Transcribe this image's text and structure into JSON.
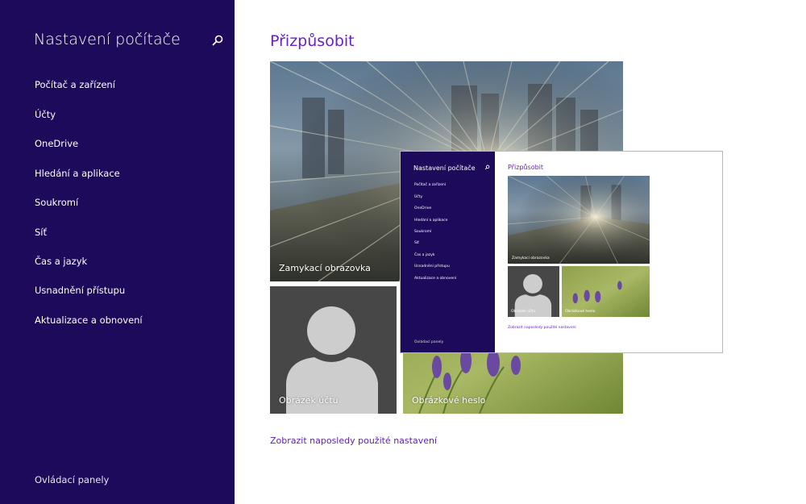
{
  "sidebar": {
    "title": "Nastavení počítače",
    "items": [
      {
        "label": "Počítač a zařízení"
      },
      {
        "label": "Účty"
      },
      {
        "label": "OneDrive"
      },
      {
        "label": "Hledání a aplikace"
      },
      {
        "label": "Soukromí"
      },
      {
        "label": "Síť"
      },
      {
        "label": "Čas a jazyk"
      },
      {
        "label": "Usnadnění přístupu"
      },
      {
        "label": "Aktualizace a obnovení"
      }
    ],
    "footer": "Ovládací panely"
  },
  "main": {
    "title": "Přizpůsobit",
    "tiles": {
      "lock_screen": "Zamykací obrazovka",
      "account_picture": "Obrázek účtu",
      "picture_password": "Obrázkové heslo"
    },
    "recent_link": "Zobrazit naposledy použité nastavení"
  },
  "preview": {
    "title": "Nastavení počítače",
    "items": [
      {
        "label": "Počítač a zařízení"
      },
      {
        "label": "Účty"
      },
      {
        "label": "OneDrive"
      },
      {
        "label": "Hledání a aplikace"
      },
      {
        "label": "Soukromí"
      },
      {
        "label": "Síť"
      },
      {
        "label": "Čas a jazyk"
      },
      {
        "label": "Usnadnění přístupu"
      },
      {
        "label": "Aktualizace a obnovení"
      }
    ],
    "footer": "Ovládací panely",
    "main_title": "Přizpůsobit",
    "tiles": {
      "lock_screen": "Zamykací obrazovka",
      "account_picture": "Obrázek účtu",
      "picture_password": "Obrázkové heslo"
    },
    "recent_link": "Zobrazit naposledy použité nastavení"
  },
  "icons": {
    "search": "search-icon",
    "account_placeholder": "user-silhouette-icon"
  },
  "colors": {
    "sidebar_bg": "#1d0a5a",
    "accent": "#6a1fc9",
    "link": "#5b1fb9",
    "account_tile_bg": "#474747",
    "silhouette": "#cdcdcd"
  }
}
